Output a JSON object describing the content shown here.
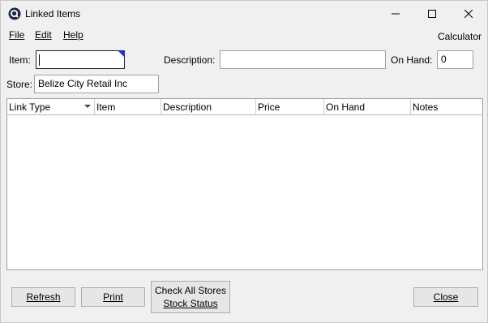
{
  "window": {
    "title": "Linked Items"
  },
  "menubar": {
    "items": [
      {
        "label": "File"
      },
      {
        "label": "Edit"
      },
      {
        "label": "Help"
      }
    ],
    "calculator_label": "Calculator"
  },
  "form": {
    "item_label": "Item:",
    "item_value": "",
    "description_label": "Description:",
    "description_value": "",
    "onhand_label": "On Hand:",
    "onhand_value": "0",
    "store_label": "Store:",
    "store_value": "Belize City Retail Inc"
  },
  "grid": {
    "columns": [
      {
        "label": "Link Type"
      },
      {
        "label": "Item"
      },
      {
        "label": "Description"
      },
      {
        "label": "Price"
      },
      {
        "label": "On Hand"
      },
      {
        "label": "Notes"
      }
    ],
    "rows": []
  },
  "buttons": {
    "refresh": "Refresh",
    "print": "Print",
    "check_line1": "Check All Stores",
    "check_line2": "Stock Status",
    "close": "Close"
  },
  "colors": {
    "accent_corner": "#1a2fd0",
    "window_bg": "#f0f0f0"
  },
  "icons": {
    "app": "app-q-icon",
    "minimize": "minimize-icon",
    "maximize": "maximize-icon",
    "close": "close-icon",
    "dropdown": "chevron-down-icon"
  }
}
